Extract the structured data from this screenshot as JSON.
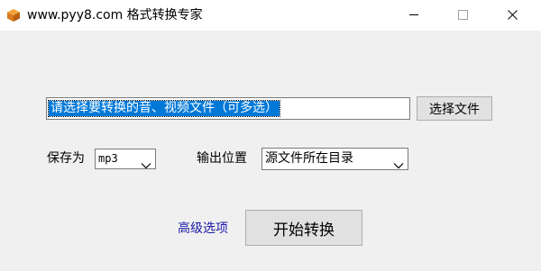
{
  "window": {
    "title": "www.pyy8.com 格式转换专家",
    "icon": "package-box-icon",
    "controls": [
      "minimize-icon",
      "maximize-icon",
      "close-icon"
    ]
  },
  "file": {
    "placeholder_text": "请选择要转换的音、视频文件（可多选）",
    "select_button_label": "选择文件"
  },
  "save_as": {
    "label": "保存为",
    "selected": "mp3"
  },
  "output_location": {
    "label": "输出位置",
    "selected": "源文件所在目录"
  },
  "actions": {
    "advanced_link": "高级选项",
    "start_button_label": "开始转换"
  },
  "colors": {
    "selection_highlight": "#0078d7",
    "link": "#1a1aa6",
    "window_background": "#f0f0f0",
    "button_background": "#e1e1e1"
  }
}
